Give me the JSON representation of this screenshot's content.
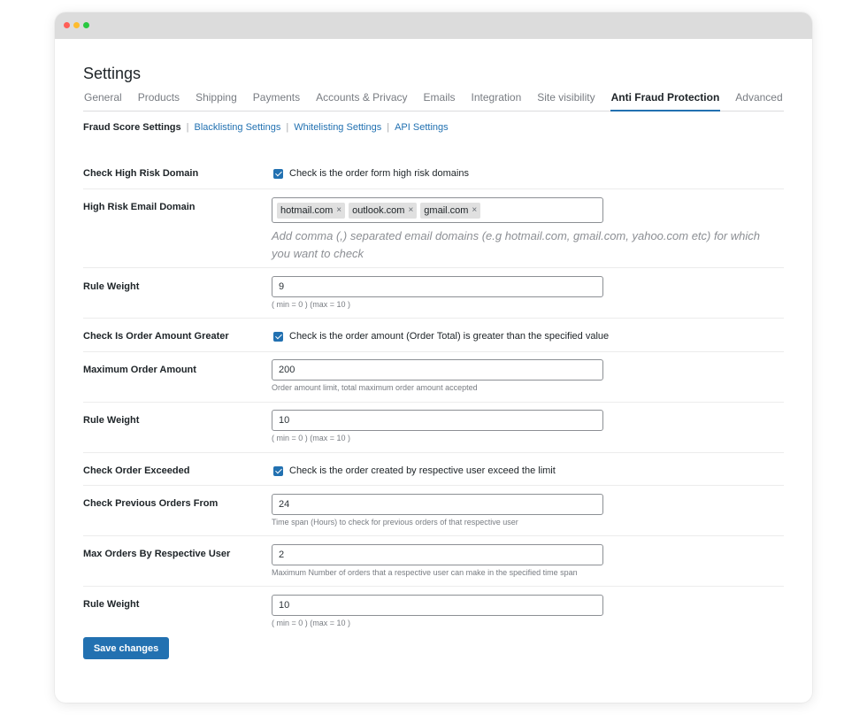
{
  "page": {
    "title": "Settings",
    "tabs": [
      {
        "label": "General"
      },
      {
        "label": "Products"
      },
      {
        "label": "Shipping"
      },
      {
        "label": "Payments"
      },
      {
        "label": "Accounts & Privacy"
      },
      {
        "label": "Emails"
      },
      {
        "label": "Integration"
      },
      {
        "label": "Site visibility"
      },
      {
        "label": "Anti Fraud Protection"
      },
      {
        "label": "Advanced"
      }
    ],
    "active_tab": "Anti Fraud Protection"
  },
  "subnav": {
    "current": "Fraud Score Settings",
    "links": [
      "Blacklisting Settings",
      "Whitelisting Settings",
      "API Settings"
    ],
    "separator": "|"
  },
  "form": {
    "high_risk_domain": {
      "label": "Check High Risk Domain",
      "checked": true,
      "checkbox_text": "Check is the order form high risk domains"
    },
    "email_domain": {
      "label": "High Risk Email Domain",
      "tags": [
        "hotmail.com",
        "outlook.com",
        "gmail.com"
      ],
      "remove_glyph": "×",
      "description": "Add comma (,) separated email domains (e.g hotmail.com, gmail.com, yahoo.com etc) for which you want to check"
    },
    "rule_weight_1": {
      "label": "Rule Weight",
      "value": "9",
      "description": "( min = 0 ) (max = 10 )"
    },
    "order_amount_greater": {
      "label": "Check Is Order Amount Greater",
      "checked": true,
      "checkbox_text": "Check is the order amount (Order Total) is greater than the specified value"
    },
    "max_order_amount": {
      "label": "Maximum Order Amount",
      "value": "200",
      "description": "Order amount limit, total maximum order amount accepted"
    },
    "rule_weight_2": {
      "label": "Rule Weight",
      "value": "10",
      "description": "( min = 0 ) (max = 10 )"
    },
    "order_exceeded": {
      "label": "Check Order Exceeded",
      "checked": true,
      "checkbox_text": "Check is the order created by respective user exceed the limit"
    },
    "previous_orders_from": {
      "label": "Check Previous Orders From",
      "value": "24",
      "description": "Time span (Hours) to check for previous orders of that respective user"
    },
    "max_orders_user": {
      "label": "Max Orders By Respective User",
      "value": "2",
      "description": "Maximum Number of orders that a respective user can make in the specified time span"
    },
    "rule_weight_3": {
      "label": "Rule Weight",
      "value": "10",
      "description": "( min = 0 ) (max = 10 )"
    }
  },
  "save_label": "Save changes",
  "colors": {
    "accent": "#2271b1",
    "text": "#1d2327",
    "muted": "#787c82"
  }
}
